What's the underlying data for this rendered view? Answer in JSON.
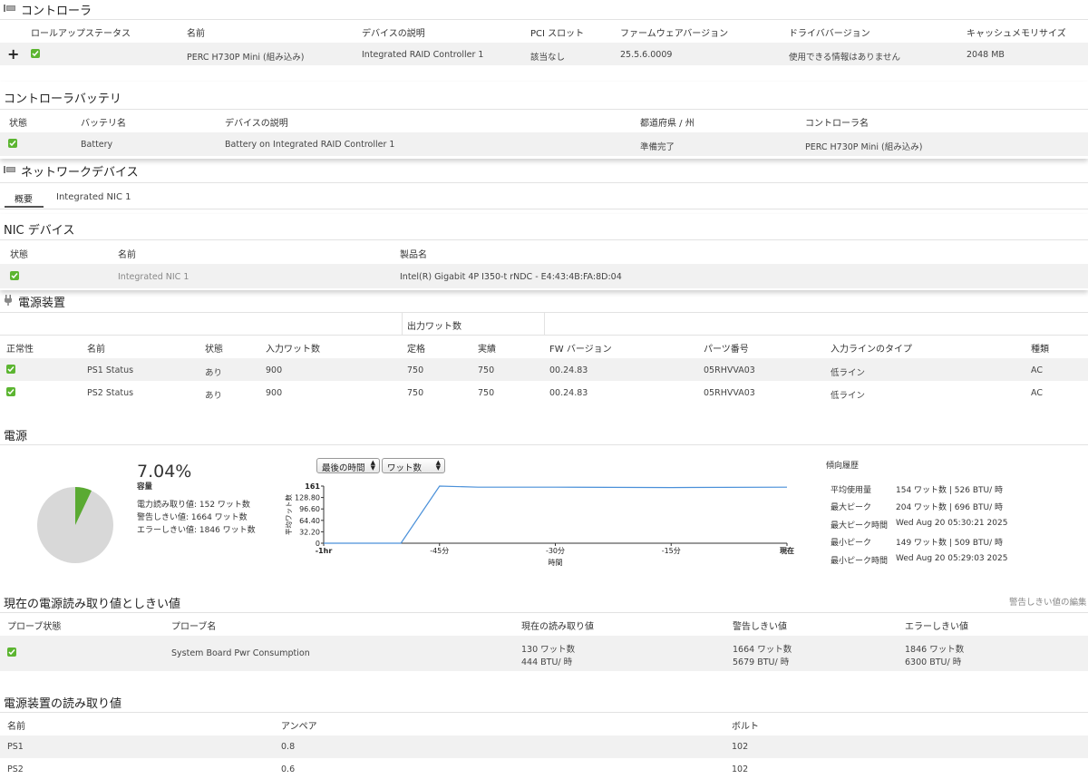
{
  "controllers": {
    "title": "コントローラ",
    "headers": [
      "ロールアップステータス",
      "名前",
      "デバイスの説明",
      "PCI スロット",
      "ファームウェアバージョン",
      "ドライババージョン",
      "キャッシュメモリサイズ"
    ],
    "row": {
      "expand": "+",
      "name": "PERC H730P Mini (組み込み)",
      "desc": "Integrated RAID Controller 1",
      "pci": "該当なし",
      "fw": "25.5.6.0009",
      "driver": "使用できる情報はありません",
      "cache": "2048 MB"
    }
  },
  "battery": {
    "title": "コントローラバッテリ",
    "headers": [
      "状態",
      "バッテリ名",
      "デバイスの説明",
      "都道府県 / 州",
      "コントローラ名"
    ],
    "row": {
      "name": "Battery",
      "desc": "Battery on Integrated RAID Controller 1",
      "state": "準備完了",
      "controller": "PERC H730P Mini (組み込み)"
    }
  },
  "network": {
    "title": "ネットワークデバイス",
    "tabs": [
      "概要",
      "Integrated NIC 1"
    ],
    "nic_title": "NIC デバイス",
    "headers": [
      "状態",
      "名前",
      "製品名"
    ],
    "row": {
      "name": "Integrated NIC 1",
      "product": "Intel(R) Gigabit 4P I350-t rNDC - E4:43:4B:FA:8D:04"
    }
  },
  "psu": {
    "title": "電源装置",
    "group_header": "出力ワット数",
    "headers": [
      "正常性",
      "名前",
      "状態",
      "入力ワット数",
      "定格",
      "実績",
      "FW バージョン",
      "パーツ番号",
      "入力ラインのタイプ",
      "種類"
    ],
    "rows": [
      {
        "name": "PS1 Status",
        "state": "あり",
        "input": "900",
        "rated": "750",
        "actual": "750",
        "fw": "00.24.83",
        "part": "05RHVVA03",
        "line": "低ライン",
        "type": "AC"
      },
      {
        "name": "PS2 Status",
        "state": "あり",
        "input": "900",
        "rated": "750",
        "actual": "750",
        "fw": "00.24.83",
        "part": "05RHVVA03",
        "line": "低ライン",
        "type": "AC"
      }
    ]
  },
  "power": {
    "title": "電源",
    "percent": "7.04%",
    "percent_value": 7.04,
    "capacity_label": "容量",
    "reading": "電力読み取り値: 152 ワット数",
    "warn": "警告しきい値: 1664 ワット数",
    "error": "エラーしきい値: 1846 ワット数",
    "select_time": "最後の時間",
    "select_unit": "ワット数",
    "colors": {
      "pie_used": "#5aaa32",
      "pie_free": "#d8d8d8",
      "line": "#4a90d9"
    },
    "trend": {
      "title": "傾向履歴",
      "rows": [
        {
          "label": "平均使用量",
          "value": "154 ワット数 | 526 BTU/ 時"
        },
        {
          "label": "最大ピーク",
          "value": "204 ワット数 | 696 BTU/ 時"
        },
        {
          "label": "最大ピーク時間",
          "value": "Wed Aug 20 05:30:21 2025"
        },
        {
          "label": "最小ピーク",
          "value": "149 ワット数 | 509 BTU/ 時"
        },
        {
          "label": "最小ピーク時間",
          "value": "Wed Aug 20 05:29:03 2025"
        }
      ]
    }
  },
  "chart_data": {
    "type": "line",
    "ylabel": "平均ワット数",
    "xlabel": "時間",
    "x_ticks": [
      "-1hr",
      "-45分",
      "-30分",
      "-15分",
      "現在"
    ],
    "y_ticks": [
      "161",
      "128.80",
      "96.60",
      "64.40",
      "32.20",
      "0"
    ],
    "ylim": [
      0,
      161
    ],
    "x": [
      -60,
      -50,
      -45,
      -40,
      -30,
      -15,
      0
    ],
    "y": [
      0,
      0,
      161,
      158,
      158,
      157,
      158
    ]
  },
  "thresholds": {
    "title": "現在の電源読み取り値としきい値",
    "edit_link": "警告しきい値の編集",
    "headers": [
      "プローブ状態",
      "プローブ名",
      "現在の読み取り値",
      "警告しきい値",
      "エラーしきい値"
    ],
    "row": {
      "name": "System Board Pwr Consumption",
      "cur1": "130 ワット数",
      "cur2": "444 BTU/ 時",
      "warn1": "1664 ワット数",
      "warn2": "5679 BTU/ 時",
      "err1": "1846 ワット数",
      "err2": "6300 BTU/ 時"
    }
  },
  "readings": {
    "title": "電源装置の読み取り値",
    "headers": [
      "名前",
      "アンペア",
      "ボルト"
    ],
    "rows": [
      {
        "name": "PS1",
        "amp": "0.8",
        "volt": "102"
      },
      {
        "name": "PS2",
        "amp": "0.6",
        "volt": "102"
      }
    ]
  }
}
